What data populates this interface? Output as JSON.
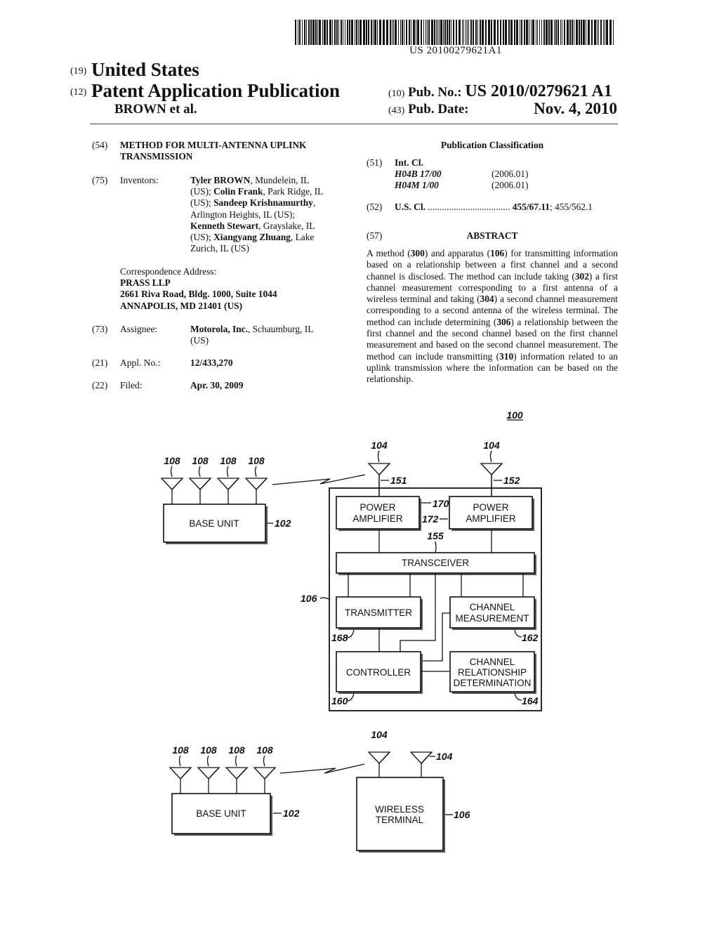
{
  "header": {
    "barcode_number": "US 20100279621A1",
    "country_tag": "(19)",
    "country": "United States",
    "pub_type_tag": "(12)",
    "pub_type": "Patent Application Publication",
    "authors": "BROWN et al.",
    "pub_no_tag": "(10)",
    "pub_no_label": "Pub. No.:",
    "pub_no": "US 2010/0279621 A1",
    "pub_date_tag": "(43)",
    "pub_date_label": "Pub. Date:",
    "pub_date": "Nov. 4, 2010"
  },
  "left": {
    "title_tag": "(54)",
    "title_line1": "METHOD FOR MULTI-ANTENNA UPLINK",
    "title_line2": "TRANSMISSION",
    "inventors_tag": "(75)",
    "inventors_label": "Inventors:",
    "inventors_lines": [
      [
        {
          "t": "Tyler BROWN",
          "b": true
        },
        {
          "t": ", Mundelein, IL",
          "b": false
        }
      ],
      [
        {
          "t": "(US); ",
          "b": false
        },
        {
          "t": "Colin Frank",
          "b": true
        },
        {
          "t": ", Park Ridge, IL",
          "b": false
        }
      ],
      [
        {
          "t": "(US); ",
          "b": false
        },
        {
          "t": "Sandeep Krishnamurthy",
          "b": true
        },
        {
          "t": ",",
          "b": false
        }
      ],
      [
        {
          "t": "Arlington Heights, IL (US);",
          "b": false
        }
      ],
      [
        {
          "t": "Kenneth Stewart",
          "b": true
        },
        {
          "t": ", Grayslake, IL",
          "b": false
        }
      ],
      [
        {
          "t": "(US); ",
          "b": false
        },
        {
          "t": "Xiangyang Zhuang",
          "b": true
        },
        {
          "t": ", Lake",
          "b": false
        }
      ],
      [
        {
          "t": "Zurich, IL (US)",
          "b": false
        }
      ]
    ],
    "correspondence_label": "Correspondence Address:",
    "correspondence_lines": [
      "PRASS LLP",
      "2661 Riva Road, Bldg. 1000, Suite 1044",
      "ANNAPOLIS, MD 21401 (US)"
    ],
    "assignee_tag": "(73)",
    "assignee_label": "Assignee:",
    "assignee_name": "Motorola, Inc.",
    "assignee_loc1": ", Schaumburg, IL",
    "assignee_loc2": "(US)",
    "appl_tag": "(21)",
    "appl_label": "Appl. No.:",
    "appl_no": "12/433,270",
    "filed_tag": "(22)",
    "filed_label": "Filed:",
    "filed_date": "Apr. 30, 2009"
  },
  "right": {
    "classification_heading": "Publication Classification",
    "intcl_tag": "(51)",
    "intcl_label": "Int. Cl.",
    "intcl": [
      {
        "code": "H04B 17/00",
        "version": "(2006.01)"
      },
      {
        "code": "H04M 1/00",
        "version": "(2006.01)"
      }
    ],
    "uscl_tag": "(52)",
    "uscl_label": "U.S. Cl.",
    "uscl_dots": "...................................",
    "uscl_primary": "455/67.11",
    "uscl_secondary": "; 455/562.1",
    "abstract_tag": "(57)",
    "abstract_heading": "ABSTRACT",
    "abstract": [
      {
        "t": "A method (",
        "b": false
      },
      {
        "t": "300",
        "b": true
      },
      {
        "t": ") and apparatus (",
        "b": false
      },
      {
        "t": "106",
        "b": true
      },
      {
        "t": ") for transmitting information based on a relationship between a first channel and a second channel is disclosed. The method can include taking (",
        "b": false
      },
      {
        "t": "302",
        "b": true
      },
      {
        "t": ") a first channel measurement corresponding to a first antenna of a wireless terminal and taking (",
        "b": false
      },
      {
        "t": "304",
        "b": true
      },
      {
        "t": ") a second channel measurement corresponding to a second antenna of the wireless terminal. The method can include determining (",
        "b": false
      },
      {
        "t": "306",
        "b": true
      },
      {
        "t": ") a relationship between the first channel and the second channel based on the first channel measurement and based on the second channel measurement. The method can include transmitting (",
        "b": false
      },
      {
        "t": "310",
        "b": true
      },
      {
        "t": ") information related to an uplink transmission where the information can be based on the relationship.",
        "b": false
      }
    ]
  },
  "figure": {
    "figure_ref": "100",
    "top": {
      "base_antenna_refs": [
        "108",
        "108",
        "108",
        "108"
      ],
      "base_unit_label": "BASE UNIT",
      "base_unit_ref": "102",
      "terminal_antenna_refs": [
        "104",
        "104"
      ],
      "feed_refs": [
        "151",
        "152"
      ],
      "terminal_ref": "106",
      "power_amp_label_line1": "POWER",
      "power_amp_label_line2": "AMPLIFIER",
      "power_amp_refs": [
        "170",
        "172"
      ],
      "bus_ref": "155",
      "transceiver_label": "TRANSCEIVER",
      "transmitter_label": "TRANSMITTER",
      "transmitter_ref": "168",
      "channel_measurement_line1": "CHANNEL",
      "channel_measurement_line2": "MEASUREMENT",
      "channel_measurement_ref": "162",
      "controller_label": "CONTROLLER",
      "controller_ref": "160",
      "crd_line1": "CHANNEL",
      "crd_line2": "RELATIONSHIP",
      "crd_line3": "DETERMINATION",
      "crd_ref": "164"
    },
    "bottom": {
      "base_antenna_refs": [
        "108",
        "108",
        "108",
        "108"
      ],
      "base_unit_label": "BASE UNIT",
      "base_unit_ref": "102",
      "terminal_antenna_refs": [
        "104",
        "104"
      ],
      "terminal_label_line1": "WIRELESS",
      "terminal_label_line2": "TERMINAL",
      "terminal_ref": "106"
    }
  }
}
